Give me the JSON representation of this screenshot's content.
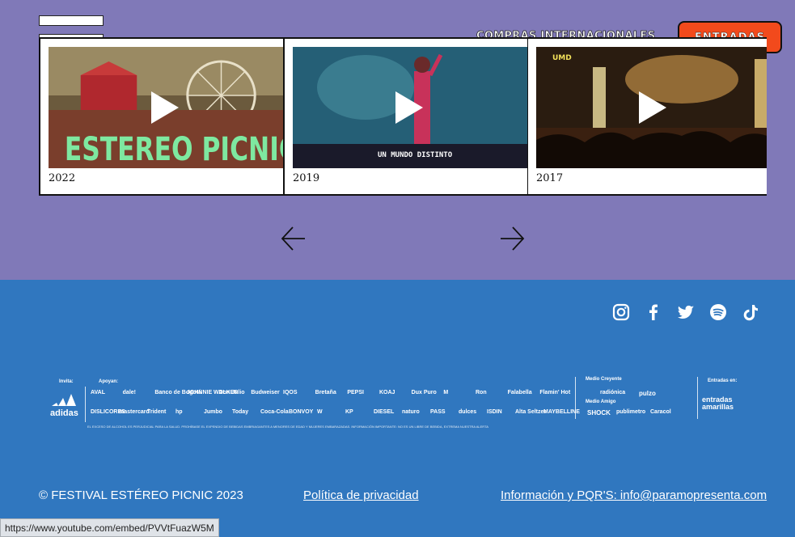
{
  "header": {
    "intl_link": "COMPRAS INTERNACIONALES",
    "cta_label": "ENTRADAS"
  },
  "carousel": {
    "videos": [
      {
        "year": "2022",
        "thumb_title": "ESTEREO PICNIC"
      },
      {
        "year": "2019",
        "thumb_caption": "UN MUNDO DISTINTO"
      },
      {
        "year": "2017",
        "thumb_badge": "UMD"
      }
    ]
  },
  "social": [
    "instagram-icon",
    "facebook-icon",
    "twitter-icon",
    "spotify-icon",
    "tiktok-icon"
  ],
  "sponsors": {
    "label_invite": "Invita:",
    "label_support": "Apoyan:",
    "label_media": "Medio Creyente",
    "label_media_friend": "Medio Amigo",
    "label_tickets": "Entradas en:",
    "invite": [
      "adidas"
    ],
    "row1": [
      "AVAL",
      "dale!",
      "Banco de Bogotá",
      "JOHNNIE WALKER",
      "Don Julio",
      "Budweiser",
      "IQOS",
      "Bretaña",
      "PEPSI",
      "KOAJ",
      "Dux Puro",
      "M",
      "Ron",
      "Falabella",
      "Flamin' Hot"
    ],
    "row2": [
      "DISLICORES",
      "mastercard",
      "Trident",
      "hp",
      "Jumbo",
      "Today",
      "Coca-Cola",
      "BONVOY",
      "W",
      "KP",
      "DIESEL",
      "naturo",
      "PASS",
      "dulces",
      "ISDIN",
      "Alta Seltzer",
      "MAYBELLINE"
    ],
    "media": [
      "radiónica",
      "pulzo",
      "SHOCK",
      "publimetro",
      "Caracol"
    ],
    "tickets": "entradas amarillas",
    "legal": "EL EXCESO DE ALCOHOL ES PERJUDICIAL PARA LA SALUD. PROHÍBASE EL EXPENDIO DE BEBIDAS EMBRIAGANTES A MENORES DE EDAD Y MUJERES EMBARAZADAS. INFORMACIÓN IMPORTANTE: NO ES UN LIBRE DE BEBIDA, EXTREMA NUESTRA ALERTA"
  },
  "footer": {
    "copyright": "© FESTIVAL ESTÉREO PICNIC 2023",
    "privacy": "Política de privacidad",
    "contact": "Información y PQR'S: info@paramopresenta.com"
  },
  "status_bar": {
    "url": "https://www.youtube.com/embed/PVVtFuazW5M"
  },
  "colors": {
    "hero_bg": "#8079b8",
    "footer_bg": "#3077bf",
    "cta_bg": "#f24a1c"
  }
}
